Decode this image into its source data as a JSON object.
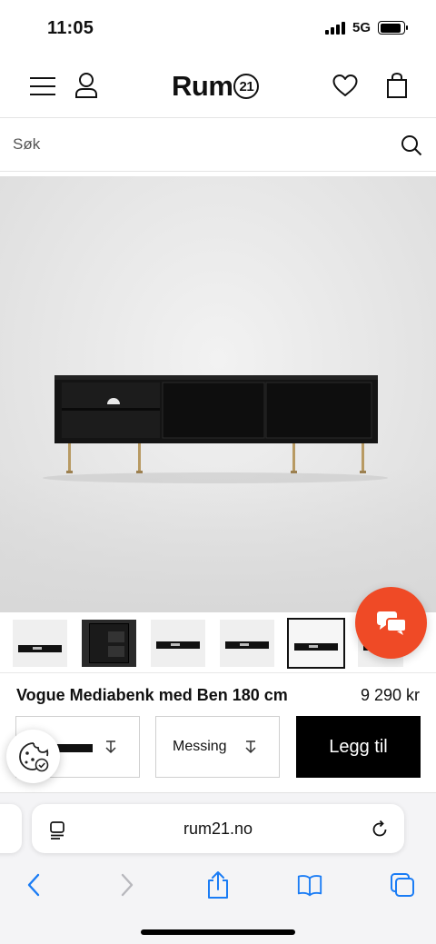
{
  "status_bar": {
    "time": "11:05",
    "network": "5G",
    "battery_level": 0.9
  },
  "header": {
    "logo_text": "Rum",
    "logo_badge": "21",
    "icons": [
      "menu-icon",
      "user-icon",
      "heart-icon",
      "bag-icon"
    ]
  },
  "search": {
    "placeholder": "Søk"
  },
  "gallery": {
    "thumbnail_count": 7,
    "selected_index": 4
  },
  "product": {
    "name": "Vogue Mediabenk med Ben 180 cm",
    "price": "9 290 kr"
  },
  "options": {
    "color_swatch": "#111111",
    "legs_label": "Messing",
    "add_to_cart_label": "Legg til"
  },
  "browser": {
    "url": "rum21.no"
  },
  "colors": {
    "accent_chat": "#ef4a26",
    "ios_blue": "#1a7cf5",
    "button_black": "#000000"
  }
}
